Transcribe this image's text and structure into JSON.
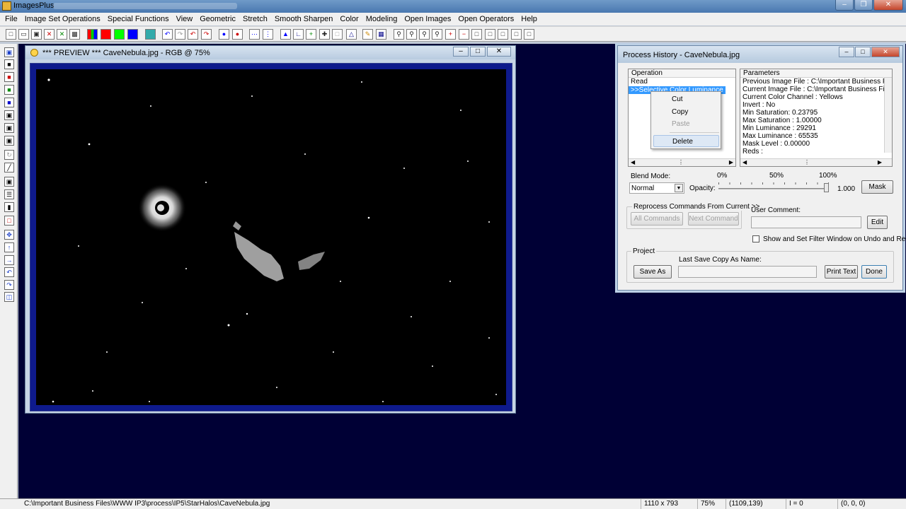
{
  "app": {
    "title": "ImagesPlus"
  },
  "menu": [
    "File",
    "Image Set Operations",
    "Special Functions",
    "View",
    "Geometric",
    "Stretch",
    "Smooth Sharpen",
    "Color",
    "Modeling",
    "Open Images",
    "Open Operators",
    "Help"
  ],
  "preview": {
    "title": "*** PREVIEW *** CaveNebula.jpg - RGB @ 75%"
  },
  "history": {
    "title": "Process History - CaveNebula.jpg",
    "operation_header": "Operation",
    "operations": [
      "Read",
      ">>Selective Color Luminance"
    ],
    "parameters_header": "Parameters",
    "parameters": [
      "Previous Image File : C:\\Important Business Files\\WW",
      "Current Image File : C:\\Important Business Files\\WW",
      "Current Color Channel : Yellows",
      "Invert : No",
      "Min Saturation: 0.23795",
      "Max Saturation : 1.00000",
      "Min Luminance : 29291",
      "Max Luminance : 65535",
      "Mask Level : 0.00000",
      "Reds :"
    ],
    "blend_mode_label": "Blend Mode:",
    "blend_mode_value": "Normal",
    "opacity_label": "Opacity:",
    "opacity_ticks": [
      "0%",
      "50%",
      "100%"
    ],
    "opacity_value": "1.000",
    "opacity_level": 1.0,
    "mask_button": "Mask",
    "reprocess_label": "Reprocess Commands From Current >>",
    "all_commands": "All Commands",
    "next_command": "Next Command",
    "user_comment_label": "User Comment:",
    "edit_button": "Edit",
    "show_filter_label": "Show and Set Filter Window on Undo and Redo",
    "project_label": "Project",
    "save_as": "Save As",
    "last_save_label": "Last Save Copy As Name:",
    "print_text": "Print Text",
    "done": "Done"
  },
  "context_menu": {
    "items": [
      "Cut",
      "Copy",
      "Paste",
      "Delete"
    ]
  },
  "status": {
    "path": "C:\\Important Business Files\\WWW IP3\\process\\IP5\\StarHalos\\CaveNebula.jpg",
    "size": "1110 x 793",
    "zoom": "75%",
    "coords": "(1109,139)",
    "intensity": "I = 0",
    "rgb": "(0, 0, 0)"
  }
}
